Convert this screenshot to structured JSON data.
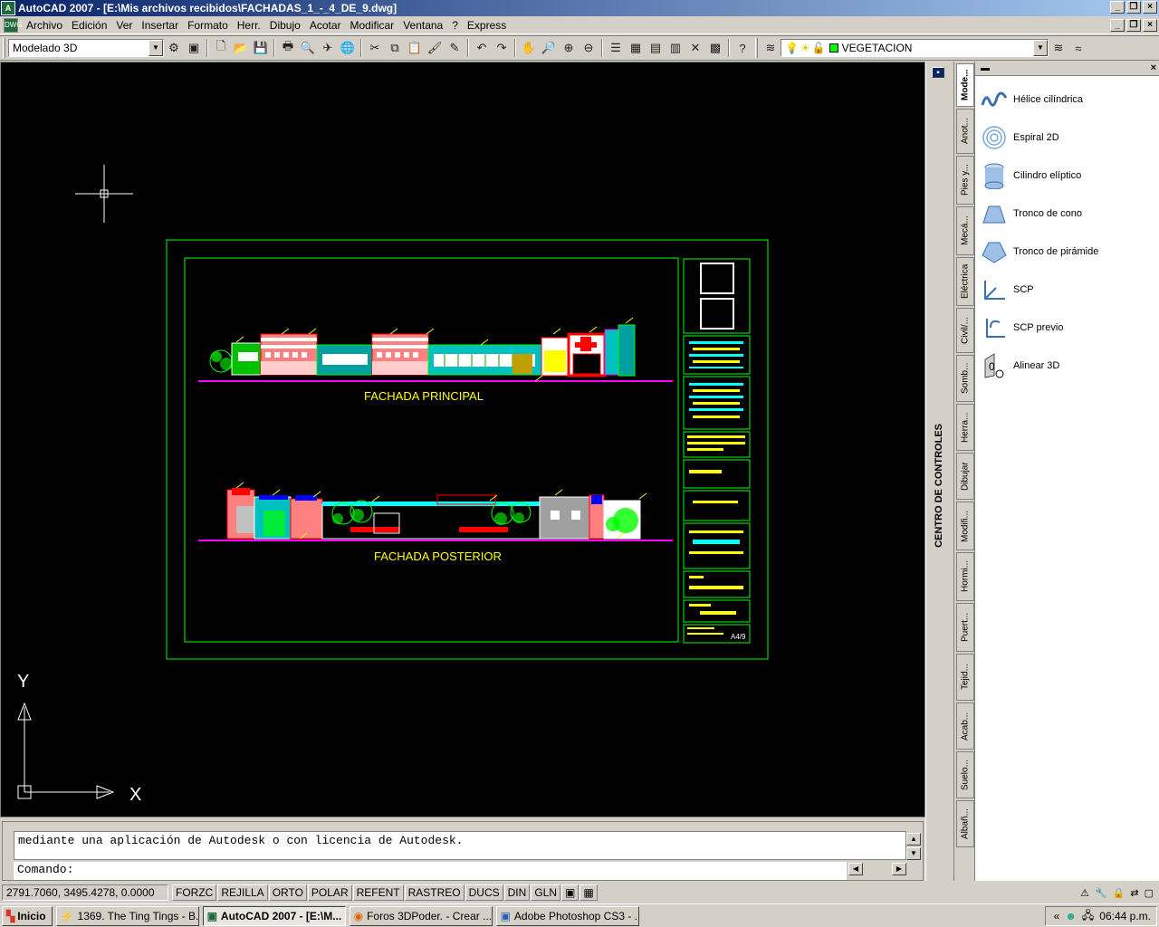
{
  "window": {
    "title": "AutoCAD 2007 - [E:\\Mis archivos recibidos\\FACHADAS_1_-_4_DE_9.dwg]",
    "app_icon": "A"
  },
  "menu": [
    "Archivo",
    "Edición",
    "Ver",
    "Insertar",
    "Formato",
    "Herr.",
    "Dibujo",
    "Acotar",
    "Modificar",
    "Ventana",
    "?",
    "Express"
  ],
  "toolbar": {
    "workspace": "Modelado 3D",
    "layer": "VEGETACION",
    "layer_color": "#00ff00"
  },
  "drawing": {
    "title_front": "FACHADA PRINCIPAL",
    "title_rear": "FACHADA POSTERIOR",
    "sheet_code": "A4/9",
    "ucs_x": "X",
    "ucs_y": "Y"
  },
  "design_center": {
    "title": "CENTRO DE CONTROLES"
  },
  "palette": {
    "tabs": [
      "Mode...",
      "Anot...",
      "Pies y...",
      "Mecá...",
      "Eléctrica",
      "Civil/...",
      "Somb...",
      "Herra...",
      "Dibujar",
      "Modifi...",
      "Hormi...",
      "Puert...",
      "Tejid...",
      "Acab...",
      "Suelo...",
      "Albañ..."
    ],
    "items": [
      {
        "label": "Hélice cilíndrica",
        "icon": "helix-icon"
      },
      {
        "label": "Espiral 2D",
        "icon": "spiral-icon"
      },
      {
        "label": "Cilindro elíptico",
        "icon": "elliptic-cylinder-icon"
      },
      {
        "label": "Tronco de cono",
        "icon": "cone-frustum-icon"
      },
      {
        "label": "Tronco de pirámide",
        "icon": "pyramid-frustum-icon"
      },
      {
        "label": "SCP",
        "icon": "ucs-icon"
      },
      {
        "label": "SCP previo",
        "icon": "ucs-previous-icon"
      },
      {
        "label": "Alinear 3D",
        "icon": "align-3d-icon"
      }
    ]
  },
  "command": {
    "history": "mediante una aplicación de Autodesk o con licencia de Autodesk.",
    "prompt": "Comando:"
  },
  "status": {
    "coords": "2791.7060, 3495.4278, 0.0000",
    "toggles": [
      "FORZC",
      "REJILLA",
      "ORTO",
      "POLAR",
      "REFENT",
      "RASTREO",
      "DUCS",
      "DIN",
      "GLN"
    ]
  },
  "taskbar": {
    "start": "Inicio",
    "tasks": [
      "1369. The Ting Tings - B...",
      "AutoCAD 2007 - [E:\\M...",
      "Foros 3DPoder. - Crear ...",
      "Adobe Photoshop CS3 - ..."
    ],
    "clock": "06:44 p.m."
  }
}
